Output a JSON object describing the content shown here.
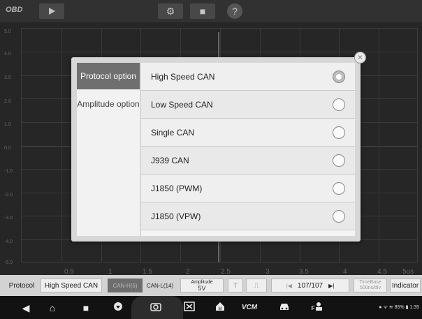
{
  "app": {
    "logo": "OBD"
  },
  "toolbar": {
    "play_icon": "play-icon",
    "settings_icon": "gear-icon",
    "folder_icon": "folder-icon",
    "help_icon": "help-icon",
    "settings_glyph": "⚙",
    "folder_glyph": "■",
    "help_glyph": "?"
  },
  "scope": {
    "y_labels": [
      "5.0",
      "4.0",
      "3.0",
      "2.0",
      "1.0",
      "0.0",
      "-1.0",
      "-2.0",
      "-3.0",
      "-4.0",
      "-5.0"
    ],
    "x_labels": [
      "0.5",
      "1",
      "1.5",
      "2",
      "2.5",
      "3",
      "3.5",
      "4",
      "4.5",
      "5us"
    ]
  },
  "dialog": {
    "close_glyph": "×",
    "tabs": [
      {
        "label": "Protocol option",
        "active": true
      },
      {
        "label": "Amplitude option",
        "active": false
      }
    ],
    "options": [
      {
        "label": "High Speed CAN",
        "selected": true
      },
      {
        "label": "Low Speed CAN",
        "selected": false
      },
      {
        "label": "Single CAN",
        "selected": false
      },
      {
        "label": "J939 CAN",
        "selected": false
      },
      {
        "label": "J1850 (PWM)",
        "selected": false
      },
      {
        "label": "J1850 (VPW)",
        "selected": false
      }
    ]
  },
  "statusbar": {
    "protocol_label": "Protocol",
    "protocol_value": "High Speed CAN",
    "can_h": "CAN-H(6)",
    "can_l": "CAN-L(14)",
    "amplitude_title": "Amplitude",
    "amplitude_value": "5V",
    "trigger": "T",
    "edge": "⎍",
    "prev": "|◀",
    "page": "107/107",
    "next": "▶|",
    "timebase_title": "TimeBase",
    "timebase_value": "500ns/div",
    "indicator": "Indicator"
  },
  "navbar": {
    "back": "◀",
    "home": "⌂",
    "recent": "■",
    "status_text": "● ᯤ ≋ 85% ▮ 1:35"
  }
}
